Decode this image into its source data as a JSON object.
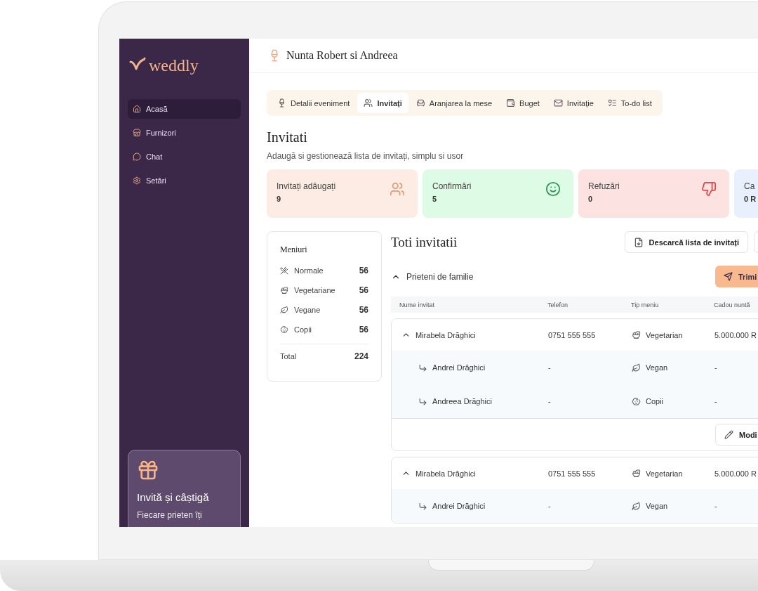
{
  "sidebar": {
    "logo": "weddly",
    "items": [
      {
        "label": "Acasă",
        "kind": "home",
        "selected": true
      },
      {
        "label": "Furnizori",
        "kind": "vendors",
        "selected": false
      },
      {
        "label": "Chat",
        "kind": "chat",
        "selected": false
      },
      {
        "label": "Setări",
        "kind": "settings",
        "selected": false
      }
    ],
    "promo": {
      "title": "Invită și câștigă",
      "text": "Fiecare prieten îți"
    }
  },
  "header": {
    "title": "Nunta Robert si Andreea"
  },
  "tabs": [
    {
      "label": "Detalii eveniment",
      "kind": "details",
      "selected": false
    },
    {
      "label": "Invitați",
      "kind": "guests",
      "selected": true
    },
    {
      "label": "Aranjarea la mese",
      "kind": "seating",
      "selected": false
    },
    {
      "label": "Buget",
      "kind": "budget",
      "selected": false
    },
    {
      "label": "Invitație",
      "kind": "invitation",
      "selected": false
    },
    {
      "label": "To-do list",
      "kind": "todo",
      "selected": false
    }
  ],
  "page": {
    "title": "Invitati",
    "subtitle": "Adaugă si gestionează lista de invitați, simplu si usor"
  },
  "stats": [
    {
      "label": "Invitați adăugați",
      "value": "9",
      "kind": "guests",
      "color": "#fdece3"
    },
    {
      "label": "Confirmări",
      "value": "5",
      "kind": "confirmed",
      "color": "#defbe6"
    },
    {
      "label": "Refuzări",
      "value": "0",
      "kind": "refused",
      "color": "#fde2e2"
    },
    {
      "label": "Ca",
      "value": "0 R",
      "kind": "other",
      "color": "#e8effd"
    }
  ],
  "menus": {
    "title": "Meniuri",
    "items": [
      {
        "label": "Normale",
        "count": "56",
        "kind": "normal"
      },
      {
        "label": "Vegetariane",
        "count": "56",
        "kind": "vegetarian"
      },
      {
        "label": "Vegane",
        "count": "56",
        "kind": "vegan"
      },
      {
        "label": "Copii",
        "count": "56",
        "kind": "kids"
      }
    ],
    "total_label": "Total",
    "total": "224"
  },
  "guests": {
    "title": "Toti invitatii",
    "download_button": "Descarcă lista de invitați",
    "group": {
      "label": "Prieteni de familie",
      "expanded": true,
      "action_button": "Trimi"
    },
    "columns": [
      "Nume invitat",
      "Telefon",
      "Tip meniu",
      "Cadou nuntă"
    ],
    "rows": [
      {
        "name": "Mirabela Drăghici",
        "phone": "0751 555 555",
        "menu": {
          "label": "Vegetarian",
          "kind": "vegetarian"
        },
        "gift": "5.000.000 R",
        "expanded": true,
        "action": "Modi",
        "children": [
          {
            "name": "Andrei Drăghici",
            "phone": "-",
            "menu": {
              "label": "Vegan",
              "kind": "vegan"
            },
            "gift": "-"
          },
          {
            "name": "Andreea Drăghici",
            "phone": "-",
            "menu": {
              "label": "Copii",
              "kind": "kids"
            },
            "gift": "-"
          }
        ]
      },
      {
        "name": "Mirabela Drăghici",
        "phone": "0751 555 555",
        "menu": {
          "label": "Vegetarian",
          "kind": "vegetarian"
        },
        "gift": "5.000.000 R",
        "expanded": true,
        "children": [
          {
            "name": "Andrei Drăghici",
            "phone": "-",
            "menu": {
              "label": "Vegan",
              "kind": "vegan"
            },
            "gift": "-"
          }
        ]
      }
    ]
  }
}
